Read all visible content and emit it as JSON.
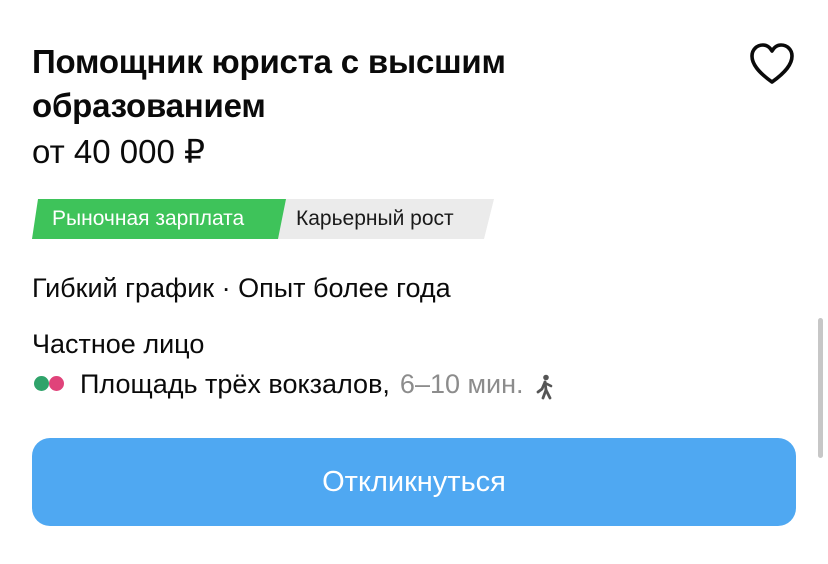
{
  "vacancy": {
    "title": "Помощник юриста с высшим образованием",
    "salary": "от 40 000 ₽",
    "tags": [
      {
        "label": "Рыночная зарплата",
        "color": "#3ec35a"
      },
      {
        "label": "Карьерный рост",
        "color": "#ebebeb"
      }
    ],
    "schedule": "Гибкий график · Опыт более года",
    "employer": "Частное лицо",
    "metro": {
      "station": "Площадь трёх вокзалов,",
      "walk_time": "6–10 мин.",
      "line_colors": [
        "#2fa36a",
        "#e0437a"
      ],
      "walk_icon": "walking-person-icon"
    },
    "favorite_icon": "heart-outline-icon",
    "apply_label": "Откликнуться"
  },
  "colors": {
    "accent": "#4fa8f2",
    "tag_green": "#3ec35a",
    "muted_text": "#8c8c8c"
  }
}
